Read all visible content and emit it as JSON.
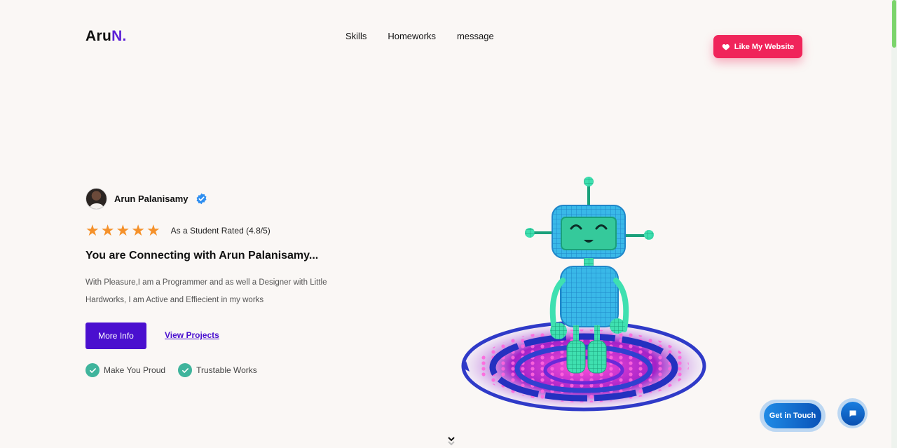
{
  "header": {
    "logo_main": "Aru",
    "logo_accent": "N.",
    "nav": [
      "Skills",
      "Homeworks",
      "message"
    ],
    "like_button": "Like My Website"
  },
  "hero": {
    "name": "Arun Palanisamy",
    "rating_text": "As a Student Rated (4.8/5)",
    "stars": 5,
    "headline": "You are Connecting with Arun Palanisamy...",
    "description": "With Pleasure,I am a Programmer and as well a Designer with Little Hardworks, I am Active and Effiecient in my works",
    "more_info": "More Info",
    "view_projects": "View Projects",
    "features": [
      "Make You Proud",
      "Trustable Works"
    ]
  },
  "floating": {
    "get_in_touch": "Get in Touch"
  },
  "colors": {
    "accent": "#5b1fd6",
    "button": "#4a0fcf",
    "like": "#f0245a",
    "star": "#f5912a",
    "check": "#3fb49c"
  }
}
